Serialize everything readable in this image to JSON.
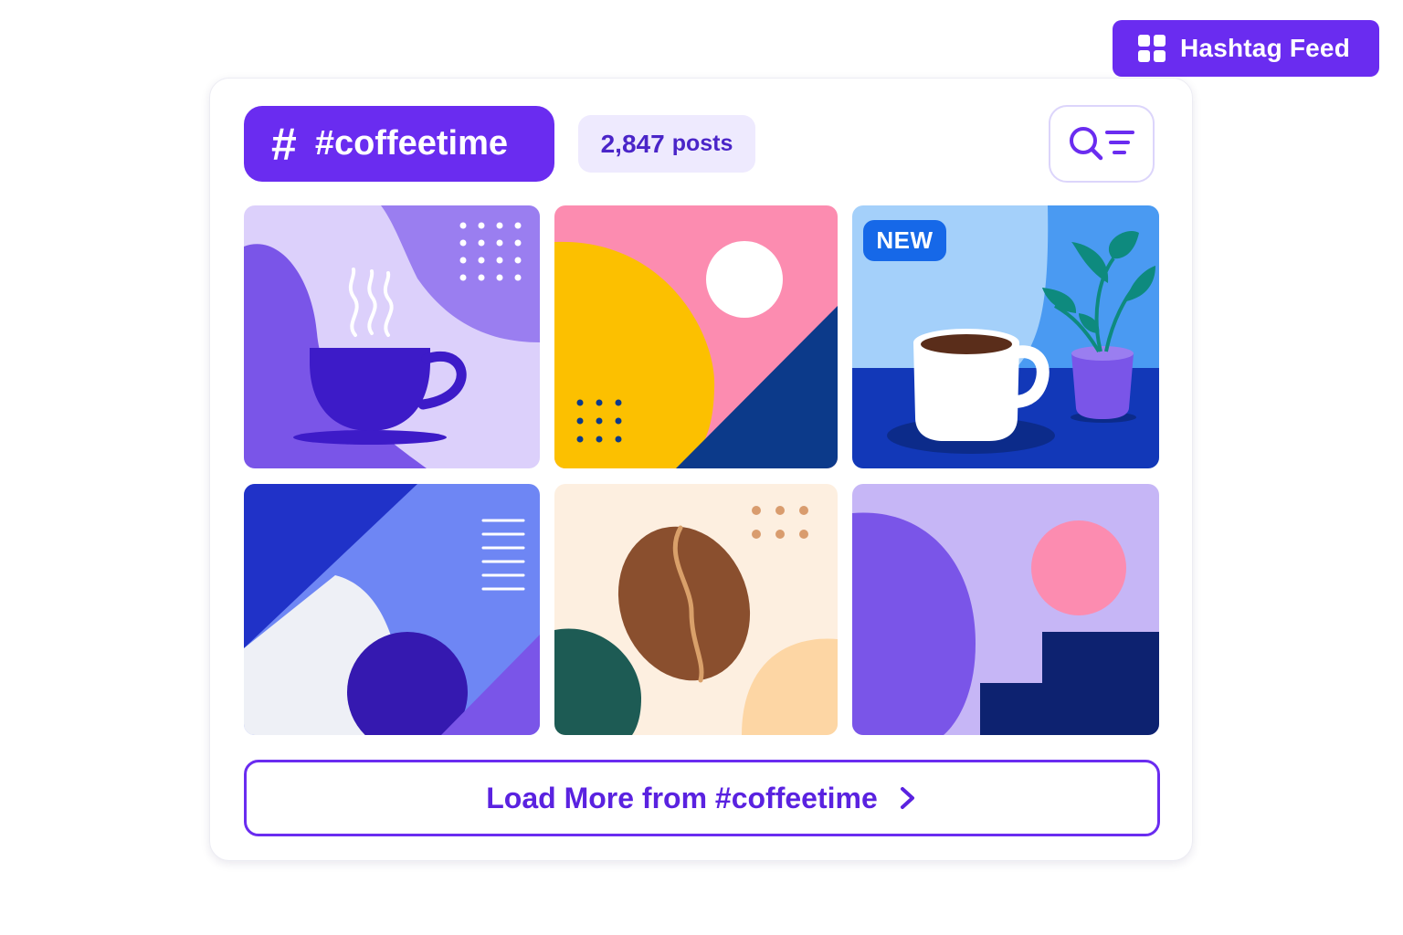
{
  "widget_badge": {
    "label": "Hashtag Feed",
    "icon": "grid-icon"
  },
  "header": {
    "hashtag": "#coffeetime",
    "hash_icon": "#",
    "post_count": "2,847",
    "post_unit": "posts",
    "filter_icon": "search-filter-icon"
  },
  "tiles": [
    {
      "name": "steaming-cup"
    },
    {
      "name": "abstract-shapes-pink"
    },
    {
      "name": "coffee-mug-plant",
      "badge": "NEW"
    },
    {
      "name": "abstract-shapes-blue"
    },
    {
      "name": "coffee-bean"
    },
    {
      "name": "abstract-shapes-lavender"
    }
  ],
  "load_more": {
    "label": "Load More from #coffeetime",
    "icon": "chevron-right-icon"
  },
  "colors": {
    "accent": "#6a2cf0",
    "accent_light": "#eeeafe",
    "badge_blue": "#1668e8"
  }
}
